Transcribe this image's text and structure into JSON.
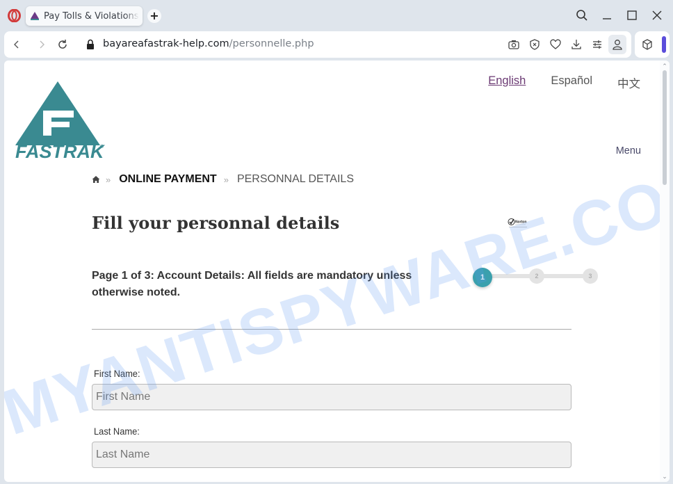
{
  "browser": {
    "tab": {
      "title": "Pay Tolls & Violations",
      "favicon": "fastrak-logo-icon"
    },
    "new_tab_label": "+",
    "address": {
      "domain": "bayareafastrak-help.com",
      "path": "/personnelle.php"
    },
    "toolbar_icons": [
      "camera-icon",
      "shield-icon",
      "heart-icon",
      "download-icon",
      "settings-sliders-icon",
      "profile-icon"
    ],
    "window_controls": [
      "search-icon",
      "minimize-icon",
      "maximize-icon",
      "close-icon"
    ],
    "colors": {
      "chrome_bg": "#dfe5ec",
      "opera_red": "#d23b3b",
      "sidebar_accent": "#5b4ddb"
    }
  },
  "page": {
    "languages": [
      {
        "label": "English",
        "active": true
      },
      {
        "label": "Español",
        "active": false
      },
      {
        "label": "中文",
        "active": false
      }
    ],
    "menu_label": "Menu",
    "logo_text": "FASTRAK",
    "breadcrumb": {
      "home_icon": "home-icon",
      "separator": "»",
      "items": [
        "ONLINE PAYMENT",
        "PERSONNAL DETAILS"
      ]
    },
    "title": "Fill your personnal details",
    "badge": "Norton",
    "page_info": "Page 1 of 3: Account Details: All fields are mandatory unless otherwise noted.",
    "stepper": {
      "current": 1,
      "steps": [
        "1",
        "2",
        "3"
      ]
    },
    "form": {
      "fields": [
        {
          "label": "First Name:",
          "placeholder": "First Name",
          "value": ""
        },
        {
          "label": "Last Name:",
          "placeholder": "Last Name",
          "value": ""
        }
      ]
    },
    "watermark": "MYANTISPYWARE.COM",
    "colors": {
      "brand_teal": "#3a8a91",
      "step_active": "#3aa0ad",
      "link_active": "#6b3a73"
    }
  }
}
